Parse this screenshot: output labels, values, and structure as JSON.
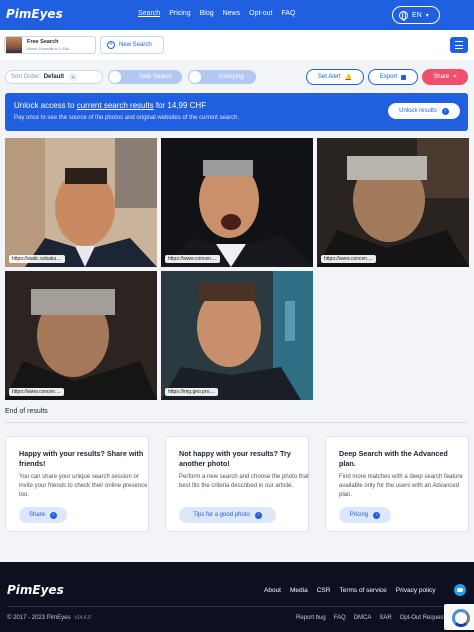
{
  "header": {
    "logo": "PimEyes",
    "nav": [
      "Search",
      "Pricing",
      "Blog",
      "News",
      "Opt-out",
      "FAQ"
    ],
    "language": "EN"
  },
  "subbar": {
    "free_title": "Free Search",
    "free_sub": "About 5 results in 1.53s",
    "new_search": "New Search"
  },
  "controls": {
    "sort_label": "Sort Order:",
    "sort_value": "Default",
    "safe_search": "Safe Search",
    "grouping": "Grouping",
    "set_alert": "Set Alert",
    "export": "Export",
    "share": "Share"
  },
  "banner": {
    "title_pre": "Unlock access to ",
    "title_link": "current search results",
    "title_post": " for 14,99 CHF",
    "subtitle": "Pay once to see the source of the photos and original websites of the current search.",
    "button": "Unlock results"
  },
  "results": [
    {
      "source": "https://static.sobaka...."
    },
    {
      "source": "https://www.concen...."
    },
    {
      "source": "https://www.concen...."
    },
    {
      "source": "https://www.concen...."
    },
    {
      "source": "https://img.geo.pro...."
    }
  ],
  "end_text": "End of results",
  "cards": [
    {
      "title": "Happy with your results? Share with friends!",
      "text": "You can share your unique search session or invite your friends to check their online presence too.",
      "button": "Share"
    },
    {
      "title": "Not happy with your results? Try another photo!",
      "text": "Perform a new search and choose the photo that best fits the criteria described in our article.",
      "button": "Tips for a good photo"
    },
    {
      "title": "Deep Search with the Advanced plan.",
      "text": "Find more matches with a deep search feature available only for the users with an Advanced plan.",
      "button": "Pricing"
    }
  ],
  "footer": {
    "logo": "PimEyes",
    "links": [
      "About",
      "Media",
      "CSR",
      "Terms of service",
      "Privacy policy"
    ],
    "copyright": "© 2017 - 2023 PimEyes",
    "version": "v14.6.0",
    "links2": [
      "Report bug",
      "FAQ",
      "DMCA",
      "SAR",
      "Opt-Out Request"
    ]
  },
  "colors": {
    "brand_blue": "#1f5fe0",
    "share_pink": "#f0506e",
    "footer_bg": "#0c1020"
  }
}
